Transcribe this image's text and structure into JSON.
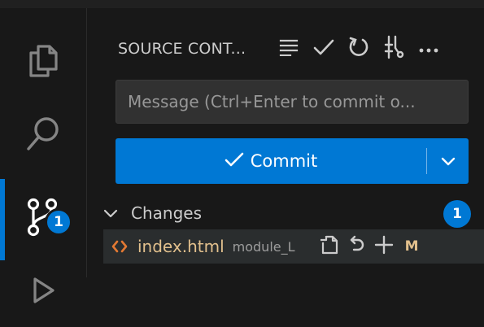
{
  "activity_bar": {
    "items": [
      {
        "icon": "explorer-icon"
      },
      {
        "icon": "search-icon"
      },
      {
        "icon": "source-control-icon",
        "badge": "1"
      },
      {
        "icon": "run-debug-icon"
      }
    ],
    "active_index": 2
  },
  "source_control": {
    "title": "SOURCE CONT...",
    "actions": [
      {
        "icon": "view-as-list-icon"
      },
      {
        "icon": "commit-check-icon"
      },
      {
        "icon": "refresh-icon"
      },
      {
        "icon": "graph-icon"
      },
      {
        "icon": "more-actions-icon"
      }
    ],
    "message_placeholder": "Message (Ctrl+Enter to commit o...",
    "commit_label": "Commit",
    "changes": {
      "label": "Changes",
      "count": "1",
      "files": [
        {
          "name": "index.html",
          "directory": "module_L",
          "status": "M",
          "actions": [
            "open-file-icon",
            "discard-changes-icon",
            "stage-changes-icon"
          ]
        }
      ]
    }
  },
  "colors": {
    "accent": "#0078d4",
    "modified": "#e2c08d",
    "html_icon": "#e37933",
    "background": "#181818"
  }
}
